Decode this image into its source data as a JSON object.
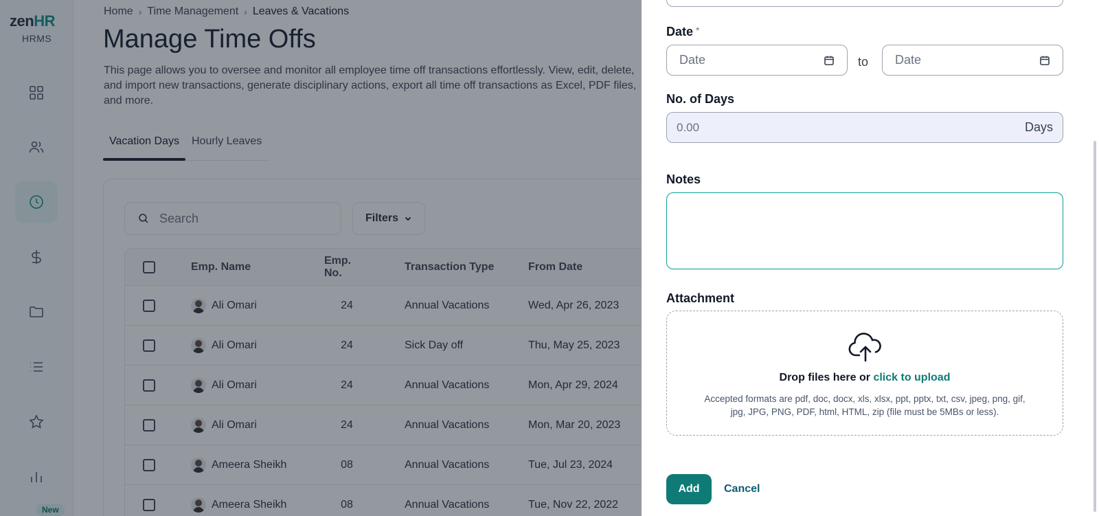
{
  "brand": {
    "logo_primary": "zen",
    "logo_accent": "HR",
    "subtitle": "HRMS"
  },
  "sidebar": {
    "items": [
      {
        "icon": "dashboard-icon"
      },
      {
        "icon": "users-icon"
      },
      {
        "icon": "clock-icon",
        "active": true
      },
      {
        "icon": "dollar-icon"
      },
      {
        "icon": "folder-icon"
      },
      {
        "icon": "list-icon"
      },
      {
        "icon": "star-icon"
      },
      {
        "icon": "bar-chart-icon"
      }
    ],
    "new_badge": "New"
  },
  "breadcrumb": {
    "items": [
      "Home",
      "Time Management",
      "Leaves & Vacations"
    ]
  },
  "page": {
    "title": "Manage Time Offs",
    "description": "This page allows you to oversee and monitor all employee time off transactions effortlessly. View, edit, delete, and import new transactions, generate disciplinary actions, export all time off transactions as Excel, PDF files, and more."
  },
  "tabs": [
    {
      "label": "Vacation Days",
      "active": true
    },
    {
      "label": "Hourly Leaves",
      "active": false
    }
  ],
  "search": {
    "placeholder": "Search"
  },
  "filters": {
    "label": "Filters"
  },
  "table": {
    "columns": [
      "Emp. Name",
      "Emp. No.",
      "Transaction Type",
      "From Date"
    ],
    "rows": [
      {
        "name": "Ali Omari",
        "no": "24",
        "type": "Annual Vacations",
        "from": "Wed, Apr 26, 2023"
      },
      {
        "name": "Ali Omari",
        "no": "24",
        "type": "Sick Day off",
        "from": "Thu, May 25, 2023"
      },
      {
        "name": "Ali Omari",
        "no": "24",
        "type": "Annual Vacations",
        "from": "Mon, Apr 29, 2024"
      },
      {
        "name": "Ali Omari",
        "no": "24",
        "type": "Annual Vacations",
        "from": "Mon, Mar 20, 2023"
      },
      {
        "name": "Ameera Sheikh",
        "no": "08",
        "type": "Annual Vacations",
        "from": "Tue, Jul 23, 2024"
      },
      {
        "name": "Ameera Sheikh",
        "no": "08",
        "type": "Annual Vacations",
        "from": "Tue, Nov 22, 2022"
      }
    ]
  },
  "drawer": {
    "date_label": "Date",
    "required_mark": "*",
    "date_from_placeholder": "Date",
    "date_to_placeholder": "Date",
    "to_text": "to",
    "days_label": "No. of Days",
    "days_placeholder": "0.00",
    "days_unit": "Days",
    "notes_label": "Notes",
    "notes_value": "",
    "attachment_label": "Attachment",
    "drop_text": "Drop files here or",
    "upload_link": "click to upload",
    "formats_text": "Accepted formats are pdf, doc, docx, xls, xlsx, ppt, pptx, txt, csv, jpeg, png, gif, jpg, JPG, PNG, PDF, html, HTML, zip (file must be 5MBs or less).",
    "add_label": "Add",
    "cancel_label": "Cancel"
  },
  "colors": {
    "accent": "#0f7b76",
    "active_nav_bg": "#e3f4f1",
    "overlay": "#1f2937",
    "days_field_bg": "#edf0fb"
  }
}
